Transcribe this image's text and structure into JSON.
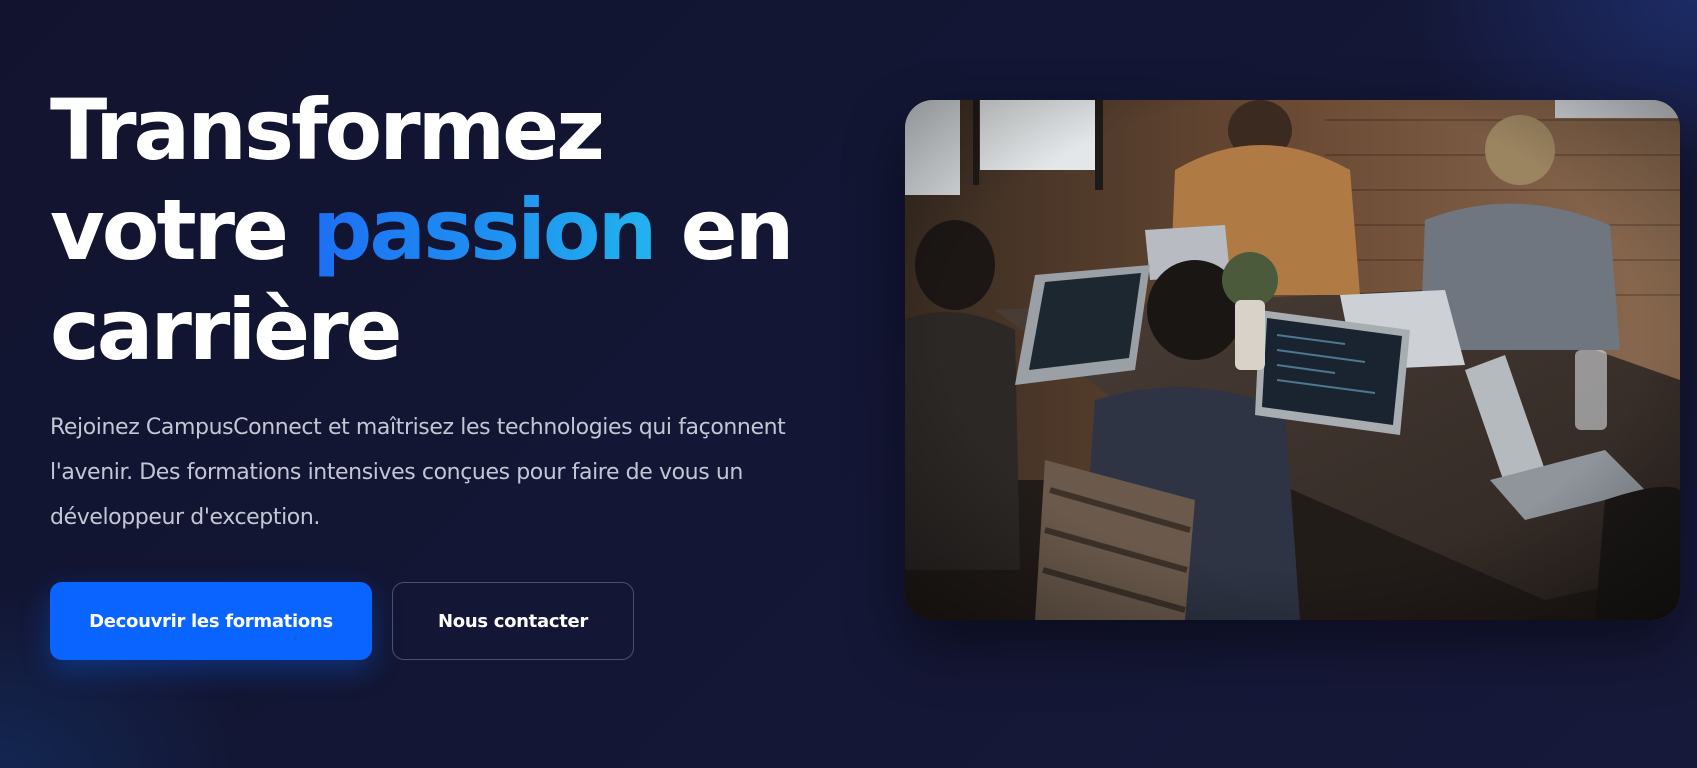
{
  "hero": {
    "title_line1": "Transformez",
    "title_line2_before": "votre ",
    "title_accent": "passion",
    "title_line2_after": " en",
    "title_line3": "carrière",
    "subtitle": "Rejoinez CampusConnect et maîtrisez les technologies qui façonnent l'avenir. Des formations intensives conçues pour faire de vous un développeur d'exception.",
    "primary_button_label": "Decouvrir les formations",
    "secondary_button_label": "Nous contacter",
    "image_description": "group-of-students-coding-on-laptops-around-table"
  },
  "colors": {
    "background": "#13163a",
    "accent_gradient_start": "#1d6ff5",
    "accent_gradient_end": "#22b3ee",
    "primary_button": "#0a64ff",
    "text_primary": "#ffffff",
    "text_secondary": "#c3c6d4"
  }
}
